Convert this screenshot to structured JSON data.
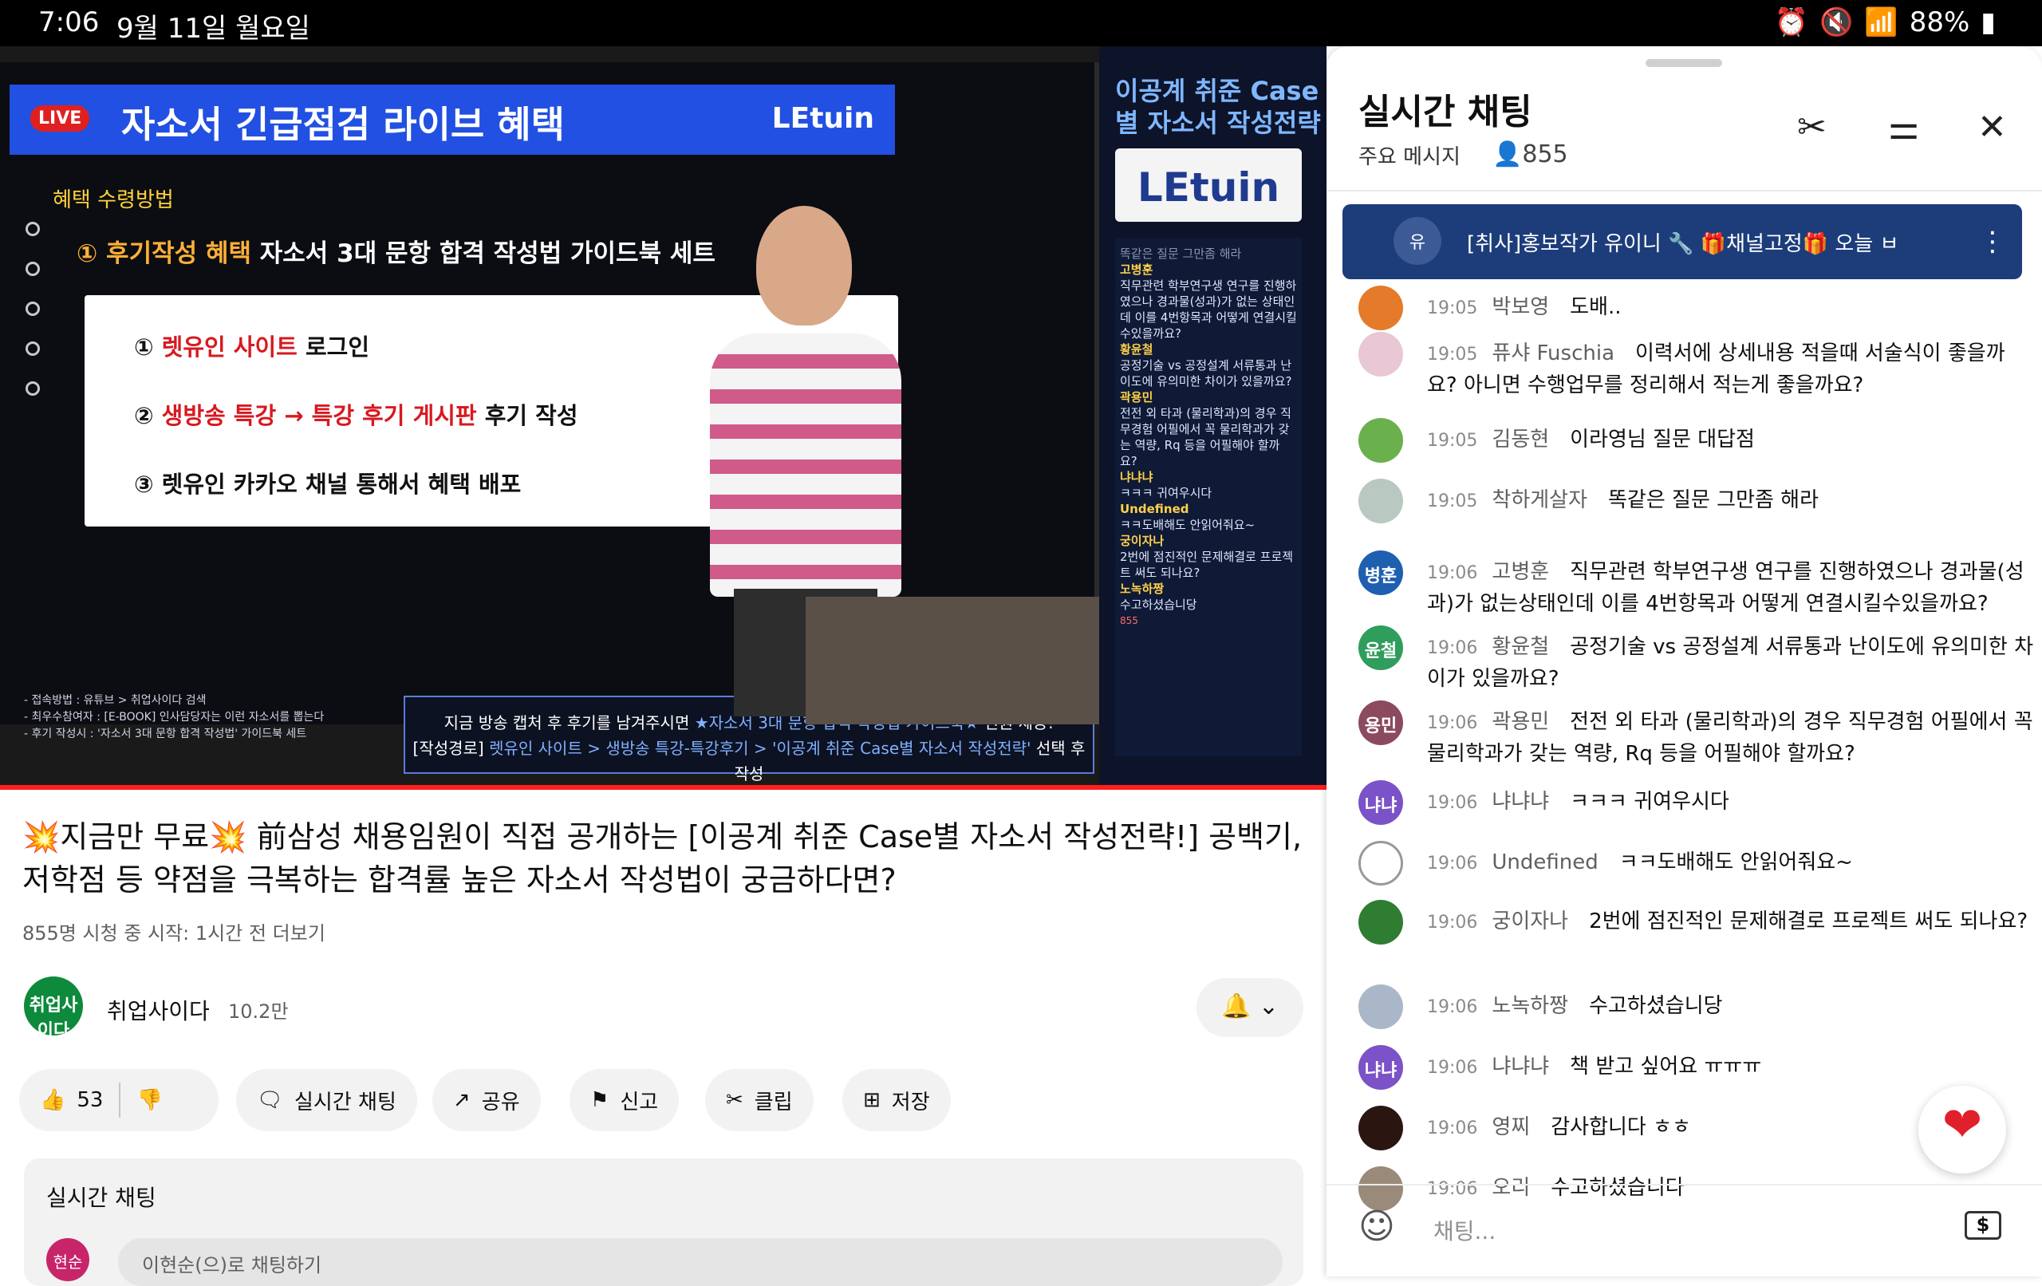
{
  "status_bar": {
    "time": "7:06",
    "date": "9월 11일 월요일",
    "battery": "88%",
    "icons": [
      "alarm-icon",
      "mute-icon",
      "wifi-icon",
      "battery-icon"
    ]
  },
  "video": {
    "board": {
      "live_badge": "LIVE",
      "title": "자소서 긴급점검 라이브 혜택",
      "brand": "LEtuin",
      "steps_label": "혜택 수령방법",
      "benefit_num": "①",
      "benefit_label": "후기작성 혜택",
      "benefit_title": "자소서 3대 문항 합격 작성법 가이드북 세트",
      "items": [
        {
          "num": "①",
          "red": "렛유인 사이트",
          "rest": " 로그인"
        },
        {
          "num": "②",
          "red": "생방송 특강 → 특강 후기 게시판",
          "rest": " 후기 작성"
        },
        {
          "num": "③",
          "red": "",
          "rest": "렛유인 카카오 채널 통해서 혜택 배포"
        }
      ],
      "footnotes": [
        "- 접속방법 : 유튜브 > 취업사이다 검색",
        "- 최우수참여자 : [E-BOOK] 인사담당자는 이런 자소서를 뽑는다",
        "- 후기 작성시 : '자소서 3대 문항 합격 작성법' 가이드북 세트"
      ],
      "caption_line1_a": "지금 방송 캡처 후 후기를 남겨주시면 ",
      "caption_line1_hl": "★자소서 3대 문항 합격 작성법 가이드북★",
      "caption_line1_b": " 전원 제공!",
      "caption_line2_a": "[작성경로] ",
      "caption_line2_hl": "렛유인 사이트 > 생방송 특강-특강후기 > '이공계 취준 Case별 자소서 작성전략'",
      "caption_line2_b": " 선택 후 작성"
    },
    "side_panel": {
      "title": "이공계 취준 Case별 자소서 작성전략",
      "logo": "LEtuin",
      "chat_header": "똑같은 질문 그만좀 해라",
      "chat": [
        {
          "name": "고병훈",
          "text": "직무관련 학부연구생 연구를 진행하였으나 경과물(성과)가 없는 상태인데 이를 4번항목과 어떻게 연결시킬수있을까요?"
        },
        {
          "name": "황윤철",
          "text": "공정기술 vs 공정설계 서류통과 난이도에 유의미한 차이가 있을까요?"
        },
        {
          "name": "곽용민",
          "text": "전전 외 타과 (물리학과)의 경우 직무경험 어필에서 꼭 물리학과가 갖는 역량, Rq 등을 어필해야 할까요?"
        },
        {
          "name": "냐냐냐",
          "text": "ㅋㅋㅋ 귀여우시다"
        },
        {
          "name": "Undefined",
          "text": "ㅋㅋ도배해도 안읽어줘요~"
        },
        {
          "name": "궁이자나",
          "text": "2번에 점진적인 문제해결로 프로젝트 써도 되나요?"
        },
        {
          "name": "노녹하짱",
          "text": "수고하셨습니당"
        }
      ],
      "viewers": "855"
    }
  },
  "title": "💥지금만 무료💥 前삼성 채용임원이 직접 공개하는 [이공계 취준 Case별 자소서 작성전략!] 공백기, 저학점 등 약점을 극복하는 합격률 높은 자소서 작성법이 궁금하다면?",
  "meta": "855명 시청 중  시작: 1시간 전  더보기",
  "channel": {
    "avatar": "취업사이다",
    "name": "취업사이다",
    "subs": "10.2만"
  },
  "actions": {
    "likes": "53",
    "live_chat": "실시간 채팅",
    "share": "공유",
    "report": "신고",
    "clip": "클립",
    "save": "저장"
  },
  "below_chat": {
    "label": "실시간 채팅",
    "avatar": "현순",
    "placeholder": "이현순(으)로 채팅하기"
  },
  "chat": {
    "title": "실시간 채팅",
    "subtitle": "주요 메시지",
    "viewer_count": "855",
    "pinned_avatar": "유",
    "pinned_text": "[취사]홍보작가 유이니 🔧 🎁채널고정🎁 오늘 ㅂ",
    "messages": [
      {
        "avatar": "",
        "color": "#e57a2a",
        "time": "19:05",
        "name": "박보영",
        "text": "도배.."
      },
      {
        "avatar": "",
        "color": "#e9c7d5",
        "time": "19:05",
        "name": "퓨샤 Fuschia",
        "text": "이력서에 상세내용 적을때 서술식이 좋을까요? 아니면 수행업무를 정리해서 적는게 좋을까요?"
      },
      {
        "avatar": "",
        "color": "#6ab04c",
        "time": "19:05",
        "name": "김동현",
        "text": "이라영님 질문 대답점"
      },
      {
        "avatar": "",
        "color": "#b9c8c0",
        "time": "19:05",
        "name": "착하게살자",
        "text": "똑같은 질문 그만좀 해라"
      },
      {
        "avatar": "병훈",
        "color": "#1f5fb0",
        "time": "19:06",
        "name": "고병훈",
        "text": "직무관련 학부연구생 연구를 진행하였으나 경과물(성과)가 없는상태인데 이를 4번항목과 어떻게 연결시킬수있을까요?"
      },
      {
        "avatar": "윤철",
        "color": "#2f9d5c",
        "time": "19:06",
        "name": "황윤철",
        "text": "공정기술 vs 공정설계 서류통과 난이도에 유의미한 차이가 있을까요?"
      },
      {
        "avatar": "용민",
        "color": "#8c4a5e",
        "time": "19:06",
        "name": "곽용민",
        "text": "전전 외 타과 (물리학과)의 경우 직무경험 어필에서 꼭 물리학과가 갖는 역량, Rq 등을 어필해야 할까요?"
      },
      {
        "avatar": "냐냐",
        "color": "#7b52c8",
        "time": "19:06",
        "name": "냐냐냐",
        "text": "ㅋㅋㅋ 귀여우시다"
      },
      {
        "avatar": "",
        "color": "#ffffff",
        "time": "19:06",
        "name": "Undefined",
        "text": "ㅋㅋ도배해도 안읽어줘요~"
      },
      {
        "avatar": "",
        "color": "#2e7d32",
        "time": "19:06",
        "name": "궁이자나",
        "text": "2번에 점진적인 문제해결로 프로젝트 써도 되나요?"
      },
      {
        "avatar": "",
        "color": "#a9b7c9",
        "time": "19:06",
        "name": "노녹하짱",
        "text": "수고하셨습니당"
      },
      {
        "avatar": "냐냐",
        "color": "#7b52c8",
        "time": "19:06",
        "name": "냐냐냐",
        "text": "책 받고 싶어요 ㅠㅠㅠ"
      },
      {
        "avatar": "",
        "color": "#2a1510",
        "time": "19:06",
        "name": "영찌",
        "text": "감사합니다 ㅎㅎ"
      },
      {
        "avatar": "",
        "color": "#9a8a7a",
        "time": "19:06",
        "name": "오리",
        "text": "수고하셨습니다"
      }
    ],
    "input_placeholder": "채팅...",
    "super_chat": "$"
  }
}
